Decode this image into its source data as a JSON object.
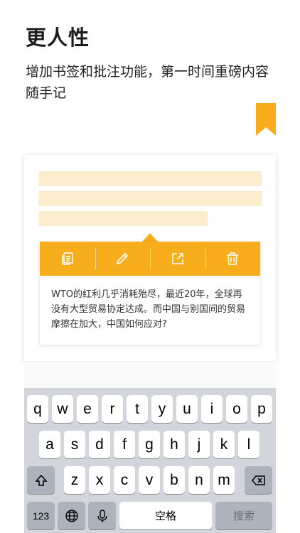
{
  "header": {
    "title": "更人性",
    "subtitle": "增加书签和批注功能，第一时间重磅内容随手记"
  },
  "popup": {
    "tools": [
      {
        "name": "copy",
        "icon": "copy-icon"
      },
      {
        "name": "annotate",
        "icon": "pencil-icon"
      },
      {
        "name": "share",
        "icon": "share-icon"
      },
      {
        "name": "delete",
        "icon": "trash-icon"
      }
    ],
    "note_text": "WTO的红利几乎消耗殆尽，最近20年，全球再没有大型贸易协定达成。而中国与别国间的贸易摩擦在加大，中国如何应对?"
  },
  "keyboard": {
    "row1": [
      "q",
      "w",
      "e",
      "r",
      "t",
      "y",
      "u",
      "i",
      "o",
      "p"
    ],
    "row2": [
      "a",
      "s",
      "d",
      "f",
      "g",
      "h",
      "j",
      "k",
      "l"
    ],
    "row3": [
      "z",
      "x",
      "c",
      "v",
      "b",
      "n",
      "m"
    ],
    "numbers_label": "123",
    "space_label": "空格",
    "search_label": "搜索"
  },
  "colors": {
    "accent": "#f8ad1d",
    "highlight": "#fdedcf",
    "keyboard_bg": "#d2d5db"
  }
}
